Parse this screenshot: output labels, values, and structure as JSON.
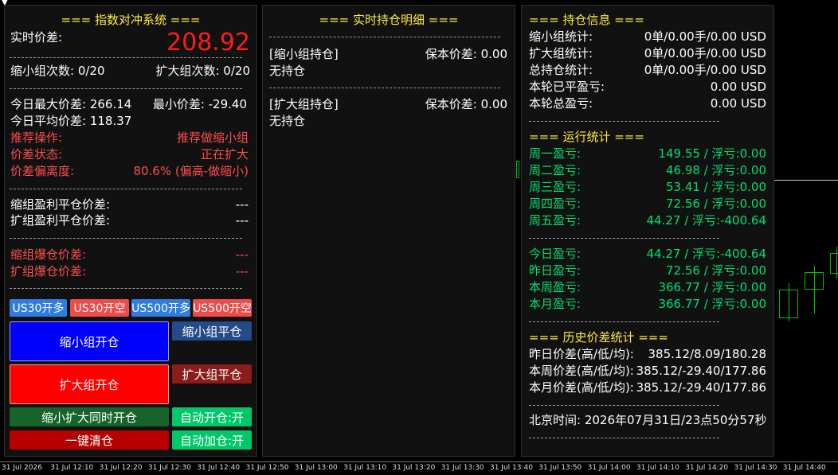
{
  "topbar": {
    "symbol": "▼"
  },
  "left": {
    "title": "=== 指数对冲系统 ===",
    "spread_label": "实时价差:",
    "spread_value": "208.92",
    "shrink_count": "缩小组次数: 0/20",
    "expand_count": "扩大组次数: 0/20",
    "today_max": "今日最大价差: 266.14",
    "today_min": "最小价差: -29.40",
    "today_avg": "今日平均价差: 118.37",
    "rec_label": "推荐操作:",
    "rec_value": "推荐做缩小组",
    "state_label": "价差状态:",
    "state_value": "正在扩大",
    "dev_label": "价差偏离度:",
    "dev_value": "80.6% (偏高-做缩小)",
    "shrink_tp_label": "缩组盈利平仓价差:",
    "shrink_tp_value": "---",
    "expand_tp_label": "扩组盈利平仓价差:",
    "expand_tp_value": "---",
    "shrink_liq_label": "缩组爆仓价差:",
    "shrink_liq_value": "---",
    "expand_liq_label": "扩组爆仓价差:",
    "expand_liq_value": "---",
    "buttons": {
      "us30_long": "US30开多",
      "us30_short": "US30开空",
      "us500_long": "US500开多",
      "us500_short": "US500开空",
      "shrink_open": "缩小组开仓",
      "shrink_close": "缩小组平仓",
      "expand_open": "扩大组开仓",
      "expand_close": "扩大组平仓",
      "both_open": "缩小扩大同时开仓",
      "auto_open": "自动开仓:开",
      "close_all": "一键清仓",
      "auto_add": "自动加仓:开"
    }
  },
  "middle": {
    "title": "=== 实时持仓明细 ===",
    "shrink_header": "[缩小组持仓]",
    "shrink_breakeven": "保本价差: 0.00",
    "shrink_none": "无持仓",
    "expand_header": "[扩大组持仓]",
    "expand_breakeven": "保本价差: 0.00",
    "expand_none": "无持仓"
  },
  "right": {
    "pos_title": "=== 持仓信息 ===",
    "pos_rows": [
      {
        "label": "缩小组统计:",
        "value": "0单/0.00手/0.00 USD"
      },
      {
        "label": "扩大组统计:",
        "value": "0单/0.00手/0.00 USD"
      },
      {
        "label": "总持仓统计:",
        "value": "0单/0.00手/0.00 USD"
      },
      {
        "label": "本轮已平盈亏:",
        "value": "0.00 USD"
      },
      {
        "label": "本轮总盈亏:",
        "value": "0.00 USD"
      }
    ],
    "run_title": "=== 运行统计 ===",
    "week_rows": [
      {
        "label": "周一盈亏:",
        "value": "149.55 / 浮亏:0.00"
      },
      {
        "label": "周二盈亏:",
        "value": "46.98 / 浮亏:0.00"
      },
      {
        "label": "周三盈亏:",
        "value": "53.41 / 浮亏:0.00"
      },
      {
        "label": "周四盈亏:",
        "value": "72.56 / 浮亏:0.00"
      },
      {
        "label": "周五盈亏:",
        "value": "44.27 / 浮亏:-400.64"
      }
    ],
    "period_rows": [
      {
        "label": "今日盈亏:",
        "value": "44.27 / 浮亏:-400.64"
      },
      {
        "label": "昨日盈亏:",
        "value": "72.56 / 浮亏:0.00"
      },
      {
        "label": "本周盈亏:",
        "value": "366.77 / 浮亏:0.00"
      },
      {
        "label": "本月盈亏:",
        "value": "366.77 / 浮亏:0.00"
      }
    ],
    "hist_title": "=== 历史价差统计 ===",
    "hist_rows": [
      {
        "label": "昨日价差(高/低/均):",
        "value": "385.12/8.09/180.28"
      },
      {
        "label": "本周价差(高/低/均):",
        "value": "385.12/-29.40/177.86"
      },
      {
        "label": "本月价差(高/低/均):",
        "value": "385.12/-29.40/177.86"
      }
    ],
    "beijing_time": "北京时间: 2026年07月31日/23点50分57秒"
  },
  "time_axis": [
    "31 Jul 2026",
    "31 Jul 12:10",
    "31 Jul 12:20",
    "31 Jul 12:30",
    "31 Jul 12:40",
    "31 Jul 12:50",
    "31 Jul 13:00",
    "31 Jul 13:10",
    "31 Jul 13:20",
    "31 Jul 13:30",
    "31 Jul 13:40",
    "31 Jul 13:50",
    "31 Jul 14:00",
    "31 Jul 14:10",
    "31 Jul 14:20",
    "31 Jul 14:30",
    "31 Jul 14:40"
  ]
}
